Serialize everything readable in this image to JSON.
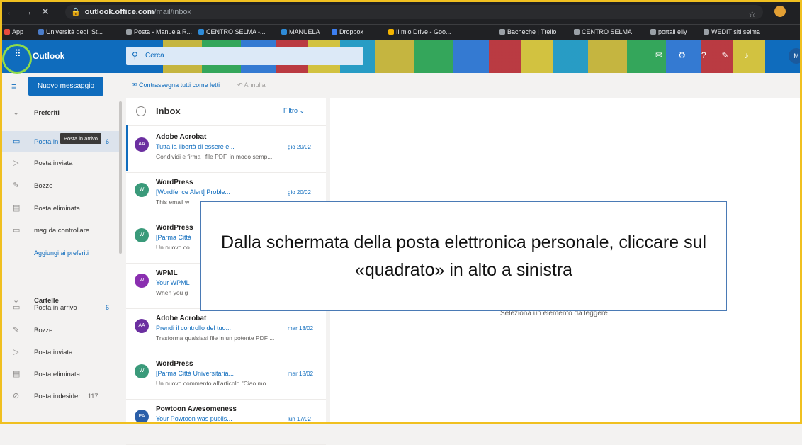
{
  "browser": {
    "url_host": "outlook.office.com",
    "url_path": "/mail/inbox",
    "bookmarks": [
      "App",
      "Università degli St...",
      "Posta - Manuela R...",
      "CENTRO SELMA -...",
      "MANUELA",
      "Dropbox",
      "Il mio Drive - Goo...",
      "Bacheche | Trello",
      "CENTRO SELMA",
      "portali elly",
      "WEDIT siti selma"
    ]
  },
  "header": {
    "brand": "Outlook",
    "search_placeholder": "Cerca",
    "avatar_initials": "M"
  },
  "toolbar": {
    "new_message": "Nuovo messaggio",
    "mark_all_read": "Contrassegna tutti come letti",
    "undo": "Annulla"
  },
  "folders": {
    "favorites": "Preferiti",
    "fav_items": [
      {
        "label": "Posta in arrivo",
        "count": "6"
      },
      {
        "label": "Posta inviata",
        "count": ""
      },
      {
        "label": "Bozze",
        "count": ""
      },
      {
        "label": "Posta eliminata",
        "count": ""
      },
      {
        "label": "msg da controllare",
        "count": ""
      }
    ],
    "add_favorite": "Aggiungi ai preferiti",
    "folders_section": "Cartelle",
    "folder_items": [
      {
        "label": "Posta in arrivo",
        "count": "6"
      },
      {
        "label": "Bozze",
        "count": ""
      },
      {
        "label": "Posta inviata",
        "count": ""
      },
      {
        "label": "Posta eliminata",
        "count": ""
      },
      {
        "label": "Posta indesider...",
        "count": "117"
      }
    ],
    "tooltip": "Posta in arrivo"
  },
  "message_list": {
    "title": "Inbox",
    "filter": "Filtro",
    "messages": [
      {
        "initials": "AA",
        "from": "Adobe Acrobat",
        "subject": "Tutta la libertà di essere e...",
        "date": "gio 20/02",
        "preview": "Condividi e firma i file PDF, in modo semp...",
        "color": "#6b2fa0"
      },
      {
        "initials": "W",
        "from": "WordPress",
        "subject": "[Wordfence Alert] Proble...",
        "date": "gio 20/02",
        "preview": "This email w",
        "color": "#3a9a7a"
      },
      {
        "initials": "W",
        "from": "WordPress",
        "subject": "[Parma Città",
        "date": "",
        "preview": "Un nuovo co",
        "color": "#3a9a7a"
      },
      {
        "initials": "W",
        "from": "WPML",
        "subject": "Your WPML",
        "date": "",
        "preview": "When you g",
        "color": "#8a2fb0"
      },
      {
        "initials": "AA",
        "from": "Adobe Acrobat",
        "subject": "Prendi il controllo del tuo...",
        "date": "mar 18/02",
        "preview": "Trasforma qualsiasi file in un potente PDF ...",
        "color": "#6b2fa0"
      },
      {
        "initials": "W",
        "from": "WordPress",
        "subject": "[Parma Città Universitaria...",
        "date": "mar 18/02",
        "preview": "Un nuovo commento all'articolo \"Ciao mo...",
        "color": "#3a9a7a"
      },
      {
        "initials": "PA",
        "from": "Powtoon Awesomeness",
        "subject": "Your Powtoon was publis...",
        "date": "lun 17/02",
        "preview": "",
        "color": "#2a5ea8"
      }
    ]
  },
  "reading_pane": {
    "empty_text": "Seleziona un elemento da leggere"
  },
  "callout": {
    "text": "Dalla schermata della posta elettronica personale, cliccare sul «quadrato» in alto a sinistra"
  }
}
